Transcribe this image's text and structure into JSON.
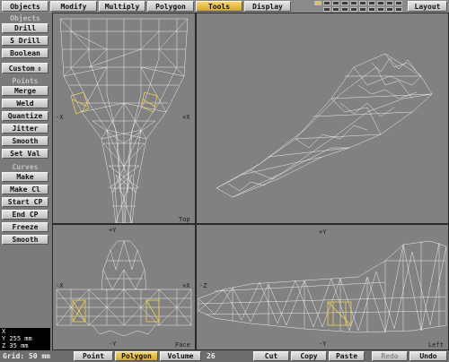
{
  "toolbar": {
    "tabs": [
      "Objects",
      "Modify",
      "Multiply",
      "Polygon",
      "Tools",
      "Display"
    ],
    "active_tab": "Tools",
    "layout_label": "Layout"
  },
  "sidebar": {
    "objects_header": "Objects",
    "objects": [
      "Drill",
      "S Drill",
      "Boolean",
      "Custom"
    ],
    "points_header": "Points",
    "points": [
      "Merge",
      "Weld",
      "Quantize",
      "Jitter",
      "Smooth",
      "Set Val"
    ],
    "curves_header": "Curves",
    "curves": [
      "Make",
      "Make Cl",
      "Start CP",
      "End CP",
      "Freeze",
      "Smooth"
    ]
  },
  "viewports": {
    "top": {
      "label": "Top"
    },
    "face": {
      "label": "Face"
    },
    "left": {
      "label": "Left"
    }
  },
  "axis": {
    "x_minus": "-X",
    "x_plus": "+X",
    "y_plus": "+Y",
    "y_minus": "-Y",
    "z_minus": "-Z",
    "z_plus": "+Z"
  },
  "coords": {
    "x": "X",
    "y": "Y 255 mm",
    "z": "Z 35 mm"
  },
  "status": {
    "grid": "Grid: 50 mm",
    "modes": [
      "Point",
      "Polygon",
      "Volume"
    ],
    "active_mode": "Polygon",
    "count": "26",
    "edit": [
      "Cut",
      "Copy",
      "Paste",
      "Redo",
      "Undo"
    ],
    "disabled_edit": "Redo"
  },
  "colors": {
    "highlight": "#f0d24a",
    "wire": "#ffffff",
    "active_button": "#e6b73a"
  }
}
